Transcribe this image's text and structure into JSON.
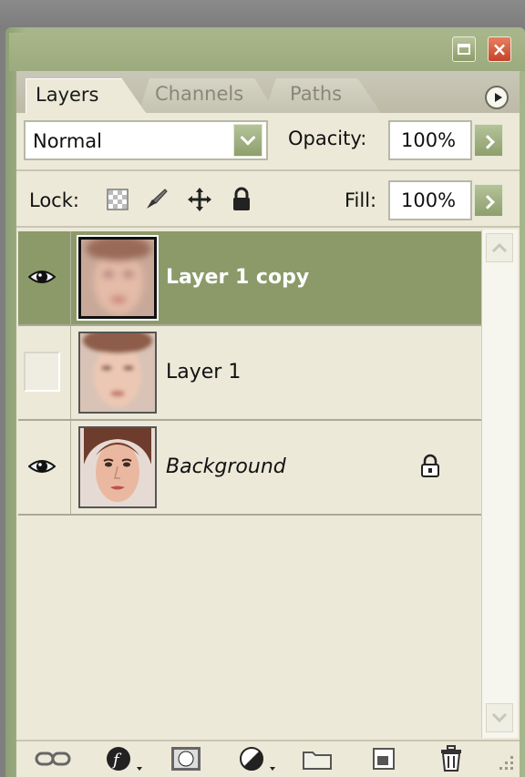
{
  "window": {
    "close_glyph": "×",
    "controls": [
      "restore-icon",
      "close-icon"
    ]
  },
  "tabs": [
    {
      "label": "Layers",
      "active": true
    },
    {
      "label": "Channels",
      "active": false
    },
    {
      "label": "Paths",
      "active": false
    }
  ],
  "options": {
    "blend_mode": "Normal",
    "opacity_label": "Opacity:",
    "opacity_value": "100%",
    "lock_label": "Lock:",
    "fill_label": "Fill:",
    "fill_value": "100%",
    "lock_icons": [
      "lock-transparency-icon",
      "lock-pixels-icon",
      "lock-position-icon",
      "lock-all-icon"
    ]
  },
  "layers": [
    {
      "name": "Layer 1 copy",
      "visible": true,
      "selected": true,
      "italic": false,
      "locked": false
    },
    {
      "name": "Layer 1",
      "visible": false,
      "selected": false,
      "italic": false,
      "locked": false
    },
    {
      "name": "Background",
      "visible": true,
      "selected": false,
      "italic": true,
      "locked": true
    }
  ],
  "bottom_icons": [
    "link-layers-icon",
    "layer-style-icon",
    "layer-mask-icon",
    "adjustment-layer-icon",
    "new-group-icon",
    "new-layer-icon",
    "delete-layer-icon"
  ],
  "colors": {
    "selected_row": "#8c9a69",
    "panel_bg": "#ece9d8",
    "xp_green": "#9cab7d",
    "close_red": "#c5432a"
  }
}
